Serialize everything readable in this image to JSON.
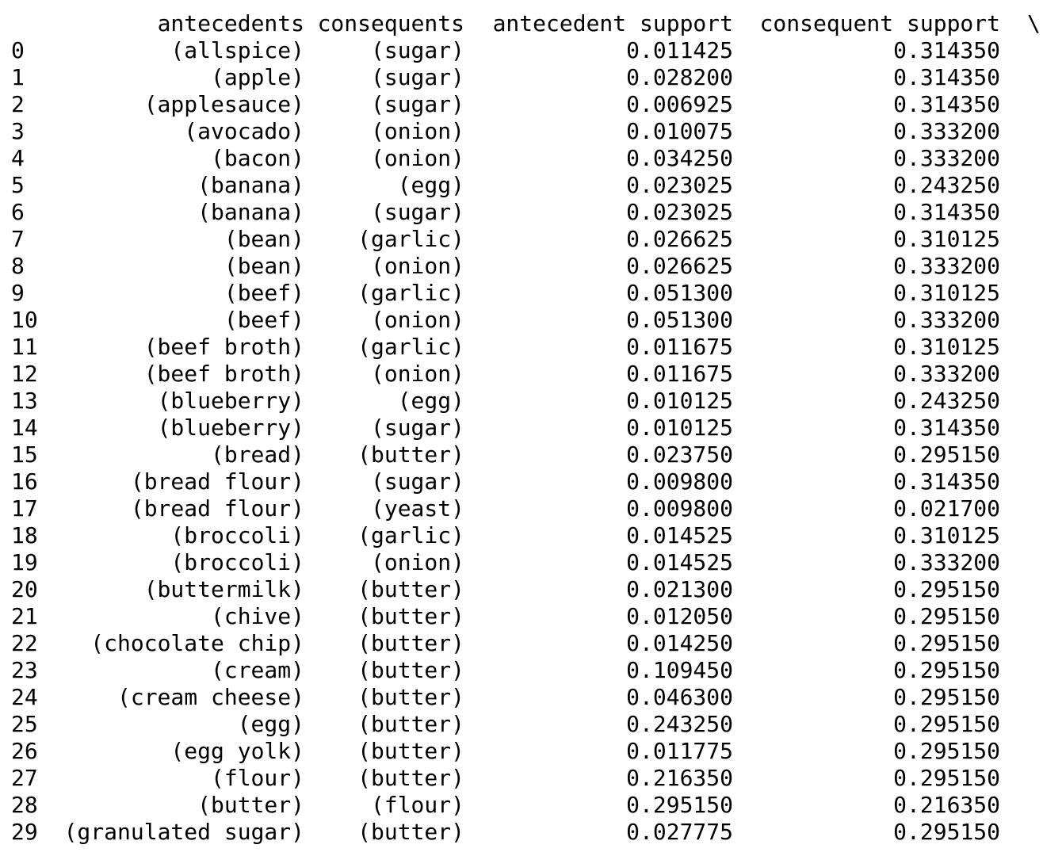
{
  "table": {
    "headers": {
      "antecedents": "antecedents",
      "consequents": "consequents",
      "antecedent_support": "antecedent support",
      "consequent_support": "consequent support",
      "continuation": "\\"
    },
    "rows": [
      {
        "index": "0",
        "antecedents": "(allspice)",
        "consequents": "(sugar)",
        "antecedent_support": "0.011425",
        "consequent_support": "0.314350"
      },
      {
        "index": "1",
        "antecedents": "(apple)",
        "consequents": "(sugar)",
        "antecedent_support": "0.028200",
        "consequent_support": "0.314350"
      },
      {
        "index": "2",
        "antecedents": "(applesauce)",
        "consequents": "(sugar)",
        "antecedent_support": "0.006925",
        "consequent_support": "0.314350"
      },
      {
        "index": "3",
        "antecedents": "(avocado)",
        "consequents": "(onion)",
        "antecedent_support": "0.010075",
        "consequent_support": "0.333200"
      },
      {
        "index": "4",
        "antecedents": "(bacon)",
        "consequents": "(onion)",
        "antecedent_support": "0.034250",
        "consequent_support": "0.333200"
      },
      {
        "index": "5",
        "antecedents": "(banana)",
        "consequents": "(egg)",
        "antecedent_support": "0.023025",
        "consequent_support": "0.243250"
      },
      {
        "index": "6",
        "antecedents": "(banana)",
        "consequents": "(sugar)",
        "antecedent_support": "0.023025",
        "consequent_support": "0.314350"
      },
      {
        "index": "7",
        "antecedents": "(bean)",
        "consequents": "(garlic)",
        "antecedent_support": "0.026625",
        "consequent_support": "0.310125"
      },
      {
        "index": "8",
        "antecedents": "(bean)",
        "consequents": "(onion)",
        "antecedent_support": "0.026625",
        "consequent_support": "0.333200"
      },
      {
        "index": "9",
        "antecedents": "(beef)",
        "consequents": "(garlic)",
        "antecedent_support": "0.051300",
        "consequent_support": "0.310125"
      },
      {
        "index": "10",
        "antecedents": "(beef)",
        "consequents": "(onion)",
        "antecedent_support": "0.051300",
        "consequent_support": "0.333200"
      },
      {
        "index": "11",
        "antecedents": "(beef broth)",
        "consequents": "(garlic)",
        "antecedent_support": "0.011675",
        "consequent_support": "0.310125"
      },
      {
        "index": "12",
        "antecedents": "(beef broth)",
        "consequents": "(onion)",
        "antecedent_support": "0.011675",
        "consequent_support": "0.333200"
      },
      {
        "index": "13",
        "antecedents": "(blueberry)",
        "consequents": "(egg)",
        "antecedent_support": "0.010125",
        "consequent_support": "0.243250"
      },
      {
        "index": "14",
        "antecedents": "(blueberry)",
        "consequents": "(sugar)",
        "antecedent_support": "0.010125",
        "consequent_support": "0.314350"
      },
      {
        "index": "15",
        "antecedents": "(bread)",
        "consequents": "(butter)",
        "antecedent_support": "0.023750",
        "consequent_support": "0.295150"
      },
      {
        "index": "16",
        "antecedents": "(bread flour)",
        "consequents": "(sugar)",
        "antecedent_support": "0.009800",
        "consequent_support": "0.314350"
      },
      {
        "index": "17",
        "antecedents": "(bread flour)",
        "consequents": "(yeast)",
        "antecedent_support": "0.009800",
        "consequent_support": "0.021700"
      },
      {
        "index": "18",
        "antecedents": "(broccoli)",
        "consequents": "(garlic)",
        "antecedent_support": "0.014525",
        "consequent_support": "0.310125"
      },
      {
        "index": "19",
        "antecedents": "(broccoli)",
        "consequents": "(onion)",
        "antecedent_support": "0.014525",
        "consequent_support": "0.333200"
      },
      {
        "index": "20",
        "antecedents": "(buttermilk)",
        "consequents": "(butter)",
        "antecedent_support": "0.021300",
        "consequent_support": "0.295150"
      },
      {
        "index": "21",
        "antecedents": "(chive)",
        "consequents": "(butter)",
        "antecedent_support": "0.012050",
        "consequent_support": "0.295150"
      },
      {
        "index": "22",
        "antecedents": "(chocolate chip)",
        "consequents": "(butter)",
        "antecedent_support": "0.014250",
        "consequent_support": "0.295150"
      },
      {
        "index": "23",
        "antecedents": "(cream)",
        "consequents": "(butter)",
        "antecedent_support": "0.109450",
        "consequent_support": "0.295150"
      },
      {
        "index": "24",
        "antecedents": "(cream cheese)",
        "consequents": "(butter)",
        "antecedent_support": "0.046300",
        "consequent_support": "0.295150"
      },
      {
        "index": "25",
        "antecedents": "(egg)",
        "consequents": "(butter)",
        "antecedent_support": "0.243250",
        "consequent_support": "0.295150"
      },
      {
        "index": "26",
        "antecedents": "(egg yolk)",
        "consequents": "(butter)",
        "antecedent_support": "0.011775",
        "consequent_support": "0.295150"
      },
      {
        "index": "27",
        "antecedents": "(flour)",
        "consequents": "(butter)",
        "antecedent_support": "0.216350",
        "consequent_support": "0.295150"
      },
      {
        "index": "28",
        "antecedents": "(butter)",
        "consequents": "(flour)",
        "antecedent_support": "0.295150",
        "consequent_support": "0.216350"
      },
      {
        "index": "29",
        "antecedents": "(granulated sugar)",
        "consequents": "(butter)",
        "antecedent_support": "0.027775",
        "consequent_support": "0.295150"
      }
    ]
  }
}
